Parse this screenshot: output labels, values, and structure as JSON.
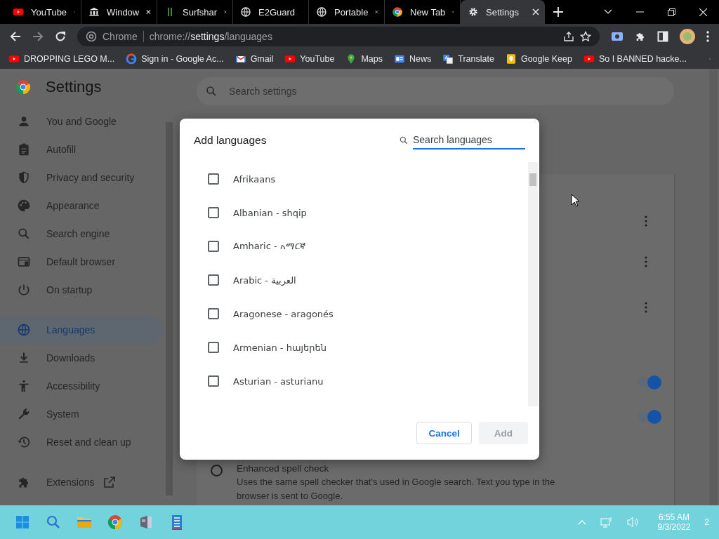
{
  "browser": {
    "tabs": [
      {
        "title": "YouTube",
        "selected": false
      },
      {
        "title": "Window",
        "selected": false
      },
      {
        "title": "Surfshar",
        "selected": false
      },
      {
        "title": "E2Guard",
        "selected": false
      },
      {
        "title": "Portable",
        "selected": false
      },
      {
        "title": "New Tab",
        "selected": false
      },
      {
        "title": "Settings",
        "selected": true
      }
    ],
    "omnibox": {
      "site": "Chrome",
      "url": "chrome://**settings**/languages"
    },
    "bookmarks": [
      {
        "title": "DROPPING LEGO M..."
      },
      {
        "title": "Sign in - Google Ac..."
      },
      {
        "title": "Gmail"
      },
      {
        "title": "YouTube"
      },
      {
        "title": "Maps"
      },
      {
        "title": "News"
      },
      {
        "title": "Translate"
      },
      {
        "title": "Google Keep"
      },
      {
        "title": "So I BANNED hacke..."
      }
    ]
  },
  "settings": {
    "title": "Settings",
    "search": {
      "placeholder": "Search settings"
    },
    "sidebar": [
      [
        {
          "label": "You and Google",
          "selected": false
        },
        {
          "label": "Autofill",
          "selected": false
        },
        {
          "label": "Privacy and security",
          "selected": false
        },
        {
          "label": "Appearance",
          "selected": false
        },
        {
          "label": "Search engine",
          "selected": false
        },
        {
          "label": "Default browser",
          "selected": false
        },
        {
          "label": "On startup",
          "selected": false
        }
      ],
      [
        {
          "label": "Languages",
          "selected": true
        },
        {
          "label": "Downloads",
          "selected": false
        },
        {
          "label": "Accessibility",
          "selected": false
        },
        {
          "label": "System",
          "selected": false
        },
        {
          "label": "Reset and clean up",
          "selected": false
        }
      ],
      [
        {
          "label": "Extensions",
          "selected": false
        }
      ]
    ],
    "card_rows": [
      {
        "kind": "menu"
      },
      {
        "kind": "menu"
      },
      {
        "kind": "menu"
      },
      {
        "kind": "toggle",
        "on": true
      },
      {
        "kind": "toggle",
        "on": true
      }
    ],
    "spell_option": {
      "label": "Enhanced spell check",
      "description": "Uses the same spell checker that's used in Google search. Text you type in the browser is sent to Google.",
      "selected": false
    }
  },
  "dialog": {
    "title": "Add languages",
    "search": {
      "placeholder": "Search languages"
    },
    "languages": [
      {
        "label": "Afrikaans",
        "checked": false
      },
      {
        "label": "Albanian - shqip",
        "checked": false
      },
      {
        "label": "Amharic - አማርኛ",
        "checked": false
      },
      {
        "label": "Arabic - العربية",
        "checked": false
      },
      {
        "label": "Aragonese - aragonés",
        "checked": false
      },
      {
        "label": "Armenian - հայերեն",
        "checked": false
      },
      {
        "label": "Asturian - asturianu",
        "checked": false
      }
    ],
    "buttons": [
      {
        "label": "Cancel",
        "disabled": false
      },
      {
        "label": "Add",
        "disabled": true
      }
    ]
  },
  "taskbar": {
    "time": "6:55 AM",
    "date": "9/3/2022",
    "notifications": "2"
  }
}
